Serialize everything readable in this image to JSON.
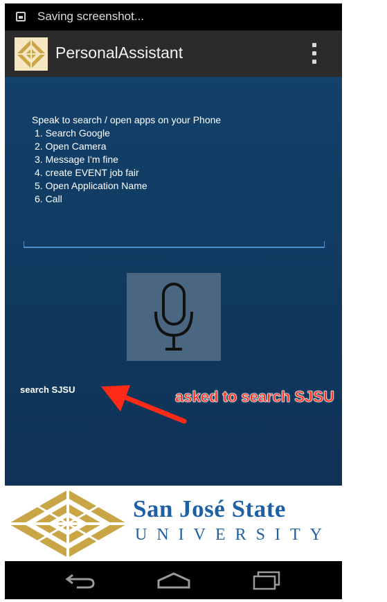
{
  "status_bar": {
    "notification_text": "Saving screenshot..."
  },
  "app": {
    "title": "PersonalAssistant"
  },
  "instructions": {
    "heading": "Speak to search / open apps on your Phone",
    "items": [
      "1. Search Google",
      "2. Open Camera",
      "3. Message I'm fine",
      "4. create EVENT job fair",
      "5. Open Application Name",
      "6. Call"
    ]
  },
  "result": {
    "text": "search SJSU"
  },
  "annotation": {
    "text": "asked to search SJSU",
    "color": "#ff2a17"
  },
  "banner": {
    "name": "San José State",
    "subtitle": "UNIVERSITY",
    "brand_blue": "#1f5fa3",
    "brand_gold": "#c9a545"
  },
  "icons": {
    "mic": "microphone-icon",
    "back": "back-icon",
    "home": "home-icon",
    "recents": "recents-icon",
    "menu": "overflow-menu-icon"
  },
  "colors": {
    "background": "#0f3256",
    "action_bar": "#2b2b2b",
    "input_line": "#4d8ecb"
  }
}
